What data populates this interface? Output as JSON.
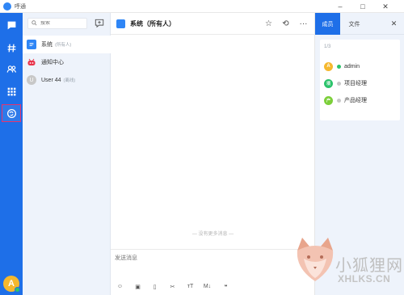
{
  "app": {
    "title": "呼通"
  },
  "window": {
    "minimize": "–",
    "maximize": "□",
    "close": "✕"
  },
  "nav": {
    "items": [
      {
        "name": "chat-nav-icon"
      },
      {
        "name": "channel-nav-icon"
      },
      {
        "name": "contacts-nav-icon"
      },
      {
        "name": "apps-nav-icon"
      },
      {
        "name": "plugin-nav-icon"
      }
    ],
    "avatar_letter": "A"
  },
  "sidebar": {
    "search_placeholder": "搜索",
    "items": [
      {
        "name": "系统",
        "tag": "(所有人)",
        "color": "#2f86f6",
        "icon": "chat-icon"
      },
      {
        "name": "通知中心",
        "tag": "",
        "color": "#e8334a",
        "icon": "bot-icon"
      },
      {
        "name": "User 44",
        "tag": "(离线)",
        "color": "#c8c8c8",
        "icon": "user-icon",
        "letter": "U"
      }
    ]
  },
  "chat": {
    "title": "系统（所有人）",
    "no_more": "— 没有更多消息 —",
    "compose_placeholder": "发送消息",
    "header_buttons": {
      "star": "☆",
      "history": "⟲",
      "more": "···"
    },
    "toolbar": {
      "emoji": "☺",
      "image": "▣",
      "file": "▯",
      "cut": "✂",
      "font": "тT",
      "markdown": "M↓",
      "quote": "❝"
    }
  },
  "panel": {
    "tabs": [
      "成员",
      "文件"
    ],
    "close": "✕",
    "count": "1/3",
    "members": [
      {
        "name": "admin",
        "letter": "A",
        "avatar_color": "#f5b82e",
        "status_color": "#2cc36b"
      },
      {
        "name": "项目经理",
        "letter": "项",
        "avatar_color": "#2cc36b",
        "status_color": "#c8c8c8"
      },
      {
        "name": "产品经理",
        "letter": "产",
        "avatar_color": "#7ccf3a",
        "status_color": "#c8c8c8"
      }
    ]
  },
  "watermark": {
    "cn": "小狐狸网",
    "en": "XHLKS.CN"
  }
}
